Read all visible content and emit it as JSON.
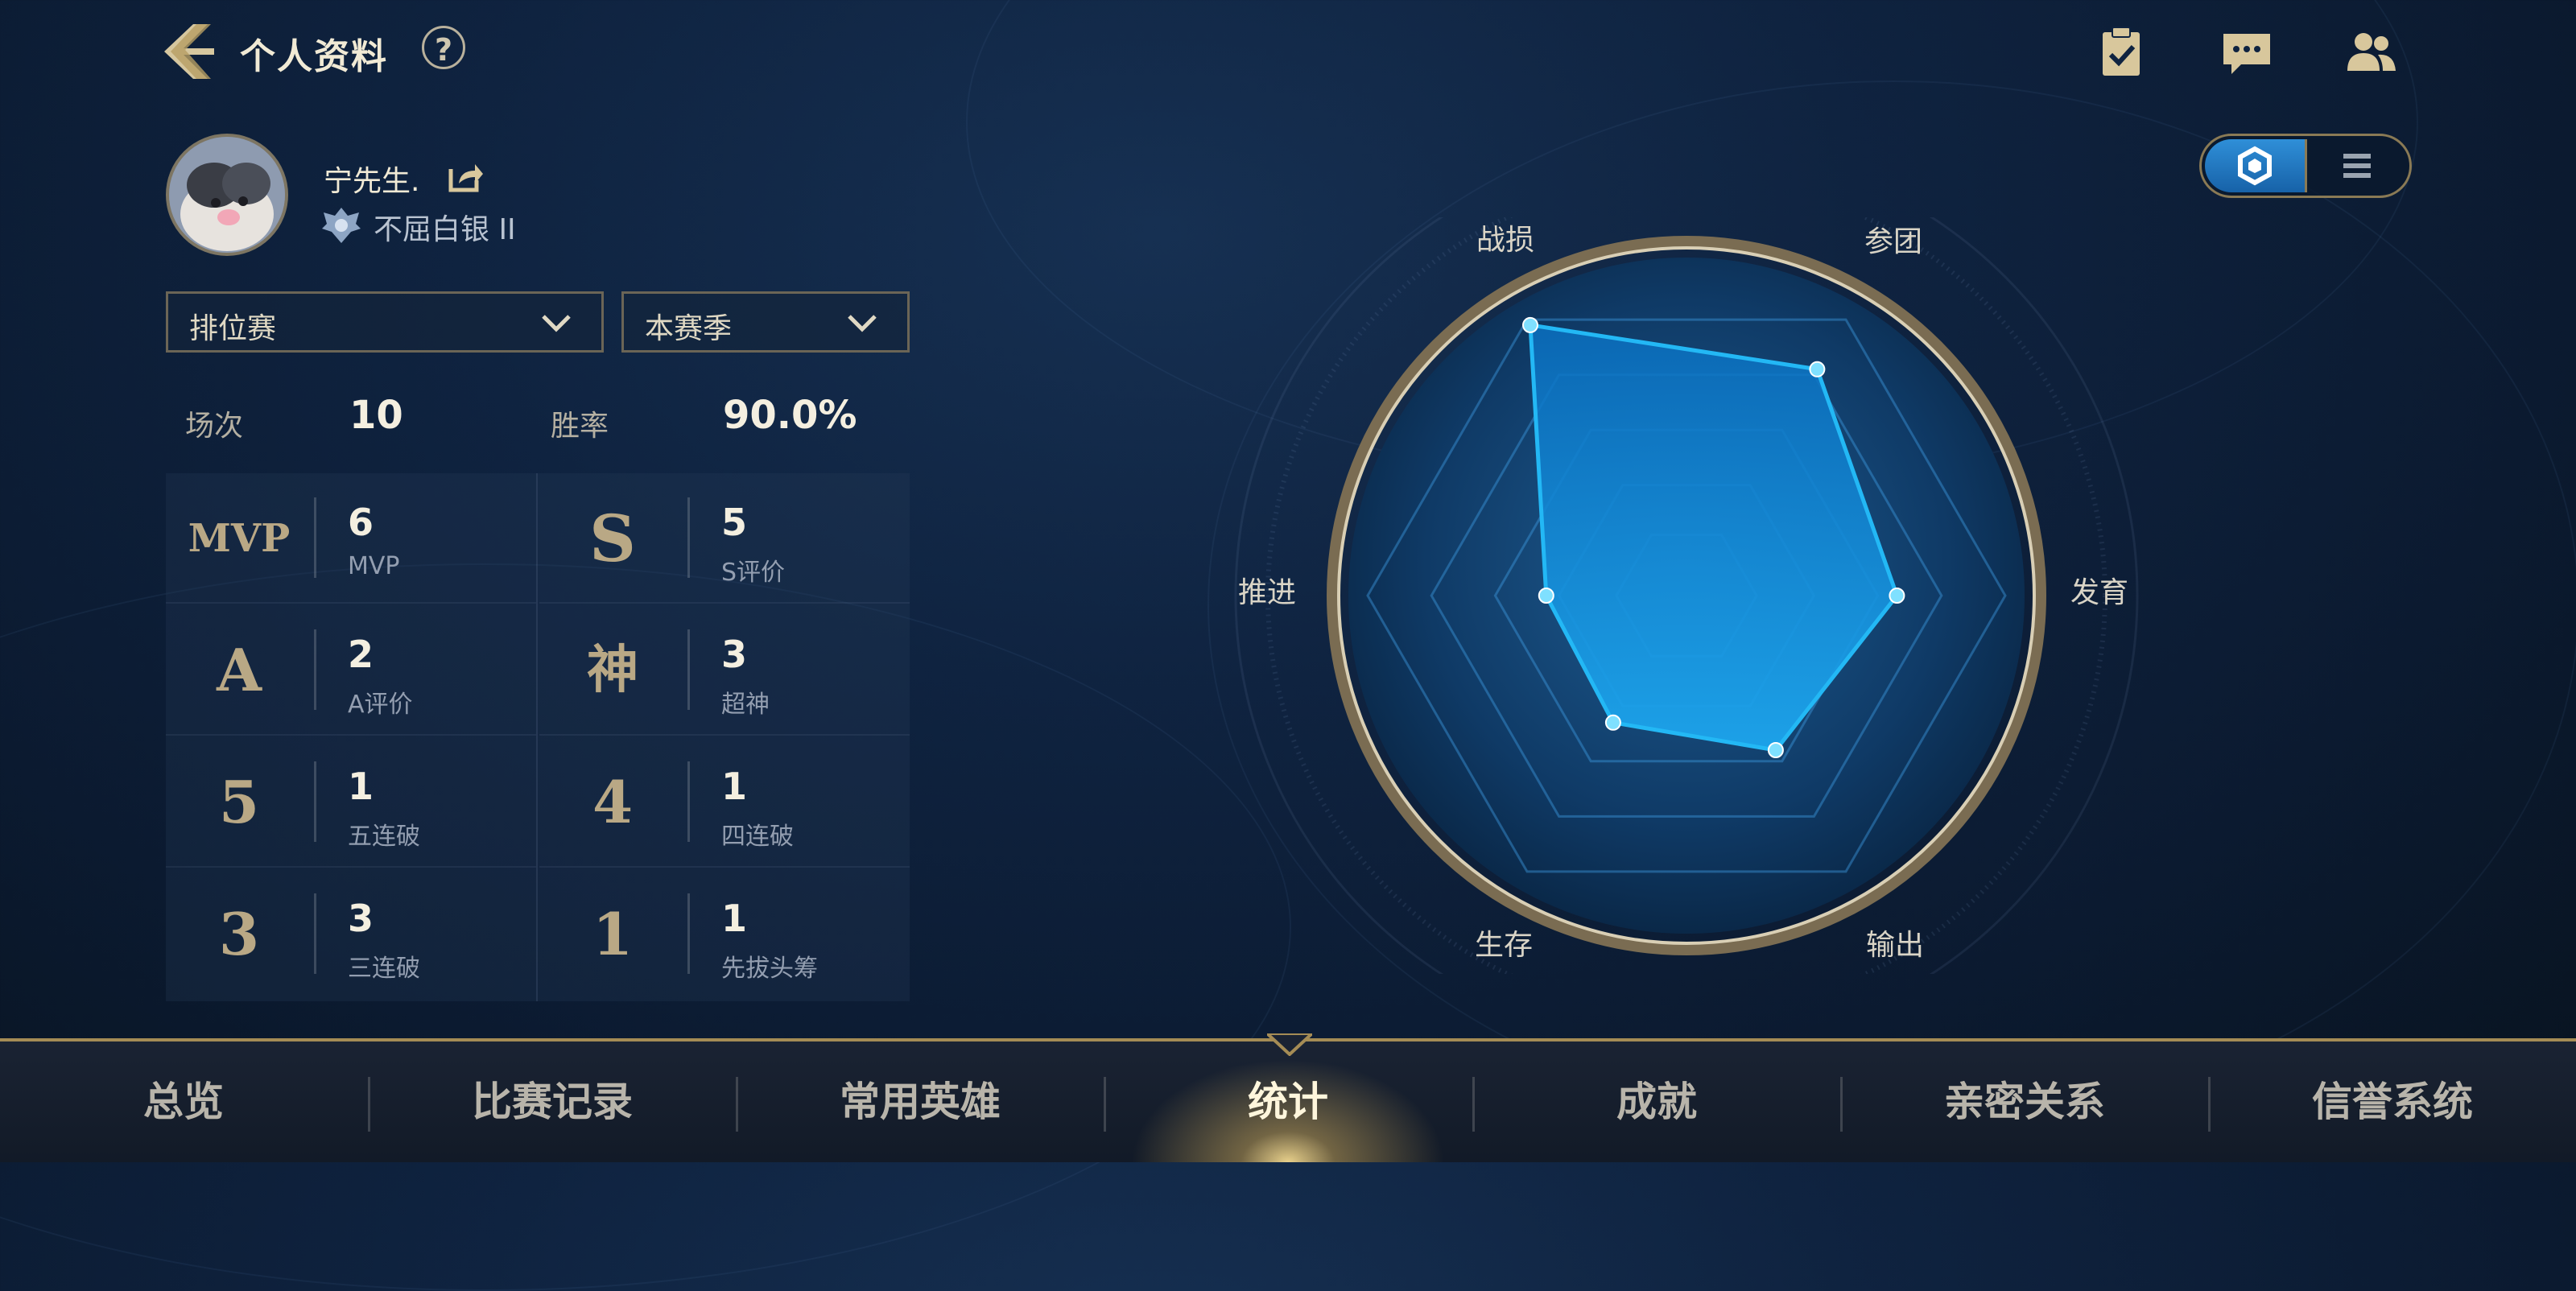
{
  "header": {
    "title": "个人资料",
    "help_label": "?"
  },
  "profile": {
    "nickname": "宁先生.",
    "rank": "不屈白银 II"
  },
  "filters": {
    "mode": "排位赛",
    "season": "本赛季"
  },
  "summary": {
    "matches_label": "场次",
    "matches_value": "10",
    "winrate_label": "胜率",
    "winrate_value": "90.0%"
  },
  "stats": [
    {
      "badge": "MVP",
      "value": "6",
      "label": "MVP"
    },
    {
      "badge": "S",
      "value": "5",
      "label": "S评价"
    },
    {
      "badge": "A",
      "value": "2",
      "label": "A评价"
    },
    {
      "badge": "神",
      "value": "3",
      "label": "超神"
    },
    {
      "badge": "5",
      "value": "1",
      "label": "五连破"
    },
    {
      "badge": "4",
      "value": "1",
      "label": "四连破"
    },
    {
      "badge": "3",
      "value": "3",
      "label": "三连破"
    },
    {
      "badge": "1",
      "value": "1",
      "label": "先拔头筹"
    }
  ],
  "radar": {
    "axes": [
      "战损",
      "参团",
      "发育",
      "输出",
      "生存",
      "推进"
    ],
    "values": [
      0.98,
      0.82,
      0.66,
      0.56,
      0.46,
      0.44
    ]
  },
  "bottom_nav": {
    "tabs": [
      "总览",
      "比赛记录",
      "常用英雄",
      "统计",
      "成就",
      "亲密关系",
      "信誉系统"
    ],
    "active_index": 3
  },
  "colors": {
    "accent_gold": "#a58c55",
    "radar_blue": "#23b8f5",
    "toggle_blue": "#2f8fd8"
  }
}
